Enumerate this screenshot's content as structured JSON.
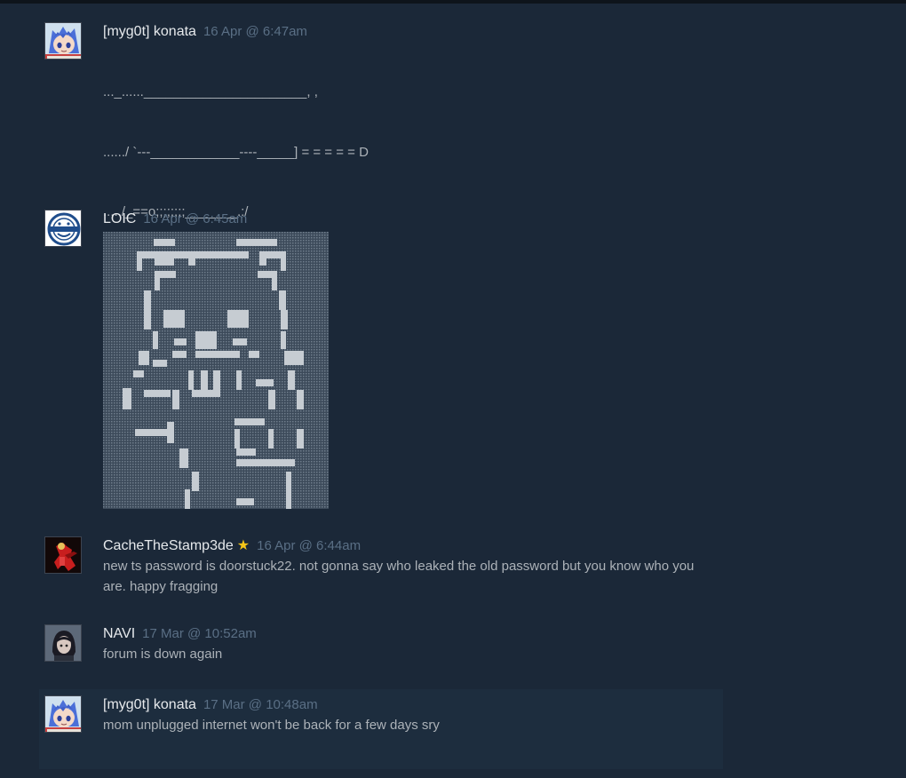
{
  "comments": [
    {
      "author": "[myg0t] konata",
      "time": "16 Apr @ 6:47am",
      "avatar": "anime-girl-blue-hair-avatar",
      "lines": [
        "..._......______________________, ,",
        "....../ `---____________----_____] = = = = = D",
        "...../_==o;;;;;;;;_______.:/",
        "....), ---.(_(__) /",
        "....// (..) ), ----\"",
        "...//___//",
        "..//___//"
      ]
    },
    {
      "author": "LOIC",
      "time": "16 Apr @ 6:45am",
      "avatar": "laughing-man-logo-avatar"
    },
    {
      "author": "CacheTheStamp3de",
      "star": "★",
      "time": "16 Apr @ 6:44am",
      "avatar": "red-armored-character-avatar",
      "text": "new ts password is doorstuck22. not gonna say who leaked the old password but you know who you are. happy fragging"
    },
    {
      "author": "NAVI",
      "time": "17 Mar @ 10:52am",
      "avatar": "dark-haired-girl-avatar",
      "text": "forum is down again"
    },
    {
      "author": "[myg0t] konata",
      "time": "17 Mar @ 10:48am",
      "avatar": "anime-girl-blue-hair-avatar",
      "text": "mom unplugged internet won't be back for a few days sry"
    }
  ],
  "colors": {
    "background": "#1b2838",
    "author": "#e6e9ec",
    "timestamp": "#5a6f85",
    "body": "#acb2b8",
    "star": "#f5c518"
  }
}
